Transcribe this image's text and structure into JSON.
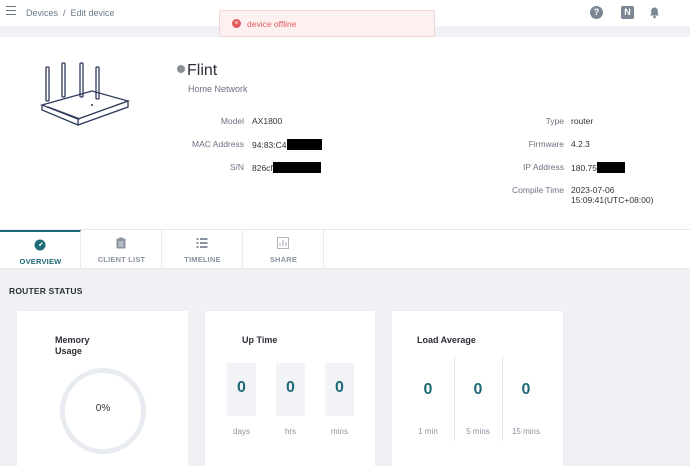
{
  "breadcrumb": {
    "root": "Devices",
    "separator": "/",
    "current": "Edit device"
  },
  "toast": {
    "message": "device offline",
    "icon": "error-icon",
    "color": "#e25c5c"
  },
  "device": {
    "name": "Flint",
    "group": "Home Network",
    "left_fields": [
      {
        "label": "Model",
        "value": "AX1800"
      },
      {
        "label": "MAC Address",
        "value": "94:83:C4"
      },
      {
        "label": "S/N",
        "value": "826cf"
      }
    ],
    "right_fields": [
      {
        "label": "Type",
        "value": "router"
      },
      {
        "label": "Firmware",
        "value": "4.2.3"
      },
      {
        "label": "IP Address",
        "value": "180.75"
      },
      {
        "label": "Compile Time",
        "value": "2023-07-06 15:09:41(UTC+08:00)"
      }
    ]
  },
  "tabs": [
    {
      "label": "OVERVIEW",
      "icon": "gauge-icon",
      "active": true
    },
    {
      "label": "CLIENT LIST",
      "icon": "clipboard-icon",
      "active": false
    },
    {
      "label": "TIMELINE",
      "icon": "list-icon",
      "active": false
    },
    {
      "label": "SHARE",
      "icon": "share-chart-icon",
      "active": false
    }
  ],
  "router_status": {
    "title": "ROUTER STATUS",
    "memory": {
      "title": "Memory Usage",
      "value": "0%"
    },
    "uptime": {
      "title": "Up Time",
      "items": [
        {
          "value": "0",
          "unit": "days"
        },
        {
          "value": "0",
          "unit": "hrs"
        },
        {
          "value": "0",
          "unit": "mins"
        }
      ]
    },
    "load": {
      "title": "Load Average",
      "items": [
        {
          "value": "0",
          "unit": "1 min"
        },
        {
          "value": "0",
          "unit": "5 mins"
        },
        {
          "value": "0",
          "unit": "15 mins"
        }
      ]
    }
  },
  "colors": {
    "accent": "#1e6a77",
    "error": "#e25c5c"
  }
}
